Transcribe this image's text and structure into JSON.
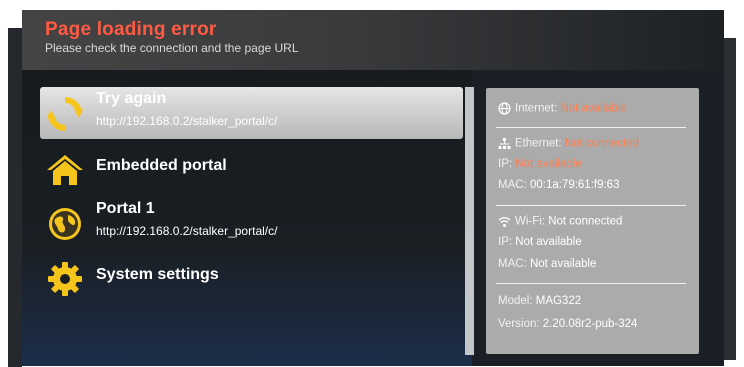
{
  "header": {
    "title": "Page loading error",
    "subtitle": "Please check the connection and the page URL"
  },
  "menu": {
    "items": [
      {
        "label": "Try again",
        "url": "http://192.168.0.2/stalker_portal/c/",
        "icon": "refresh-icon",
        "selected": true
      },
      {
        "label": "Embedded portal",
        "url": "",
        "icon": "home-icon",
        "selected": false
      },
      {
        "label": "Portal 1",
        "url": "http://192.168.0.2/stalker_portal/c/",
        "icon": "globe-icon",
        "selected": false
      },
      {
        "label": "System settings",
        "url": "",
        "icon": "gear-icon",
        "selected": false
      }
    ]
  },
  "status": {
    "internet": {
      "label": "Internet:",
      "value": "Not available"
    },
    "ethernet": {
      "label": "Ethernet:",
      "value": "Not connected",
      "ip_label": "IP:",
      "ip_value": "Not available",
      "mac_label": "MAC:",
      "mac_value": "00:1a:79:61:f9:63"
    },
    "wifi": {
      "label": "Wi-Fi:",
      "value": "Not connected",
      "ip_label": "IP:",
      "ip_value": "Not available",
      "mac_label": "MAC:",
      "mac_value": "Not available"
    },
    "device": {
      "model_label": "Model:",
      "model_value": "MAG322",
      "version_label": "Version:",
      "version_value": "2.20.08r2-pub-324"
    }
  },
  "colors": {
    "accent_title": "#ff5a43",
    "icon_yellow": "#f5c51b",
    "warning": "#ff7e4f",
    "panel_bg": "#ababab"
  }
}
